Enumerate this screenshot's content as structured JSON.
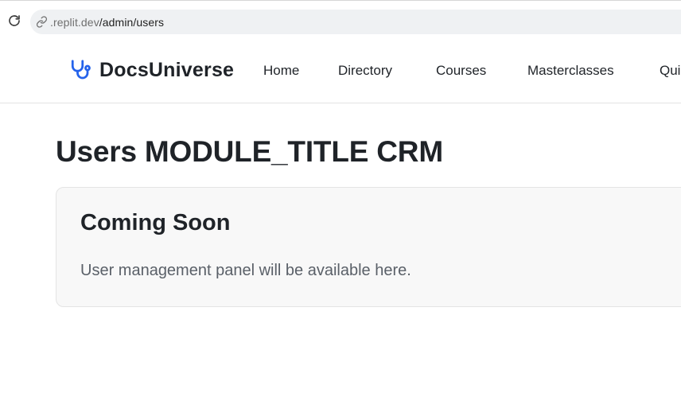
{
  "browser": {
    "url_host": ".replit.dev",
    "url_path": "/admin/users",
    "icons": {
      "reload": "reload-icon",
      "address": "link-icon"
    }
  },
  "header": {
    "brand": "DocsUniverse",
    "brand_icon": "stethoscope-icon",
    "brand_color": "#2563eb",
    "nav": [
      {
        "label": "Home"
      },
      {
        "label": "Directory"
      },
      {
        "label": "Courses"
      },
      {
        "label": "Masterclasses"
      },
      {
        "label": "Qui"
      }
    ]
  },
  "main": {
    "title": "Users MODULE_TITLE CRM",
    "card": {
      "title": "Coming Soon",
      "text": "User management panel will be available here."
    }
  }
}
